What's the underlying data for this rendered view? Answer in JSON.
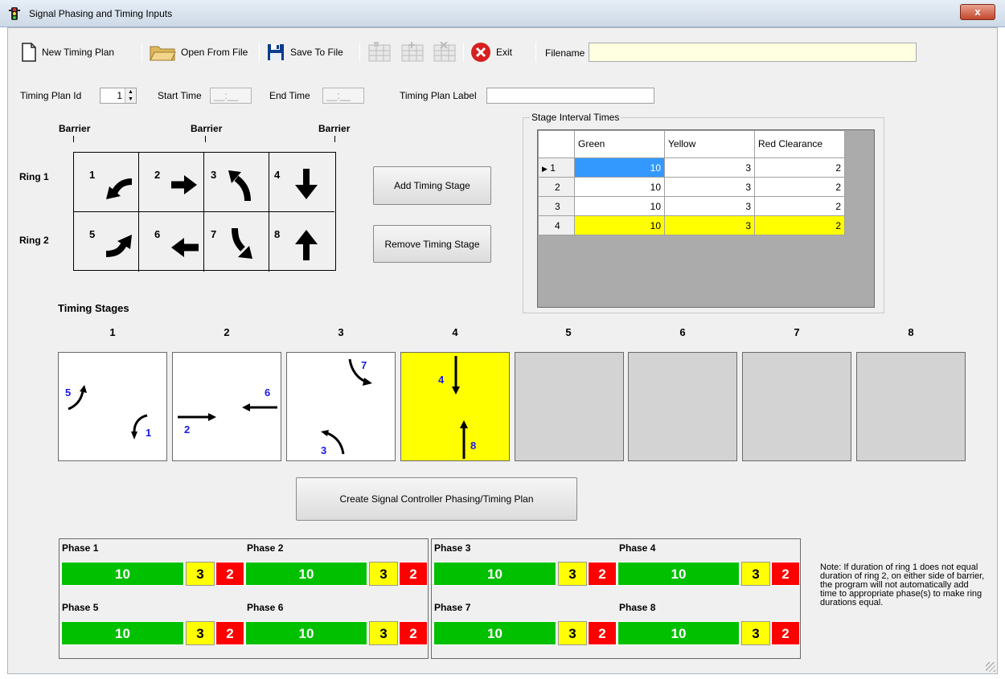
{
  "window": {
    "title": "Signal Phasing and Timing Inputs",
    "close_glyph": "x"
  },
  "toolbar": {
    "new_plan": "New Timing Plan",
    "open_file": "Open From File",
    "save_file": "Save To File",
    "exit": "Exit",
    "filename_label": "Filename",
    "filename_value": ""
  },
  "plan": {
    "id_label": "Timing Plan Id",
    "id_value": "1",
    "start_label": "Start Time",
    "start_value": "__:__",
    "end_label": "End Time",
    "end_value": "__:__",
    "plan_label_label": "Timing Plan Label",
    "plan_label_value": ""
  },
  "rings": {
    "barrier_label": "Barrier",
    "ring1_label": "Ring 1",
    "ring2_label": "Ring 2",
    "phases": [
      {
        "num": "1",
        "arrow": "left-turn-arrow-icon"
      },
      {
        "num": "2",
        "arrow": "right-arrow-icon"
      },
      {
        "num": "3",
        "arrow": "up-left-turn-arrow-icon"
      },
      {
        "num": "4",
        "arrow": "down-arrow-icon"
      },
      {
        "num": "5",
        "arrow": "right-turn-arrow-icon"
      },
      {
        "num": "6",
        "arrow": "left-arrow-icon"
      },
      {
        "num": "7",
        "arrow": "down-right-turn-arrow-icon"
      },
      {
        "num": "8",
        "arrow": "up-arrow-icon"
      }
    ]
  },
  "buttons": {
    "add_stage": "Add Timing Stage",
    "remove_stage": "Remove Timing Stage",
    "create_plan": "Create Signal Controller Phasing/Timing Plan"
  },
  "intervals": {
    "title": "Stage Interval Times",
    "columns": [
      "Green",
      "Yellow",
      "Red Clearance"
    ],
    "rows": [
      {
        "stage": "1",
        "green": "10",
        "yellow": "3",
        "red": "2"
      },
      {
        "stage": "2",
        "green": "10",
        "yellow": "3",
        "red": "2"
      },
      {
        "stage": "3",
        "green": "10",
        "yellow": "3",
        "red": "2"
      },
      {
        "stage": "4",
        "green": "10",
        "yellow": "3",
        "red": "2"
      }
    ],
    "row_pointer": "▶"
  },
  "stages": {
    "title": "Timing Stages",
    "labels": [
      "1",
      "2",
      "3",
      "4",
      "5",
      "6",
      "7",
      "8"
    ],
    "diagrams": [
      {
        "a": "5",
        "b": "1"
      },
      {
        "a": "2",
        "b": "6"
      },
      {
        "a": "7",
        "b": "3"
      },
      {
        "a": "4",
        "b": "8"
      }
    ]
  },
  "phase_bars": [
    {
      "name": "Phase 1",
      "green": "10",
      "yellow": "3",
      "red": "2"
    },
    {
      "name": "Phase 2",
      "green": "10",
      "yellow": "3",
      "red": "2"
    },
    {
      "name": "Phase 3",
      "green": "10",
      "yellow": "3",
      "red": "2"
    },
    {
      "name": "Phase 4",
      "green": "10",
      "yellow": "3",
      "red": "2"
    },
    {
      "name": "Phase 5",
      "green": "10",
      "yellow": "3",
      "red": "2"
    },
    {
      "name": "Phase 6",
      "green": "10",
      "yellow": "3",
      "red": "2"
    },
    {
      "name": "Phase 7",
      "green": "10",
      "yellow": "3",
      "red": "2"
    },
    {
      "name": "Phase 8",
      "green": "10",
      "yellow": "3",
      "red": "2"
    }
  ],
  "note": "Note: If duration of ring 1 does not equal duration of ring 2, on either side of barrier, the program will not automatically add time to appropriate phase(s) to make ring durations equal.",
  "colors": {
    "selected_stage": "#ffff00",
    "green": "#00c000",
    "yellow": "#ffff00",
    "red": "#ff0000",
    "row_select": "#3399ff"
  }
}
